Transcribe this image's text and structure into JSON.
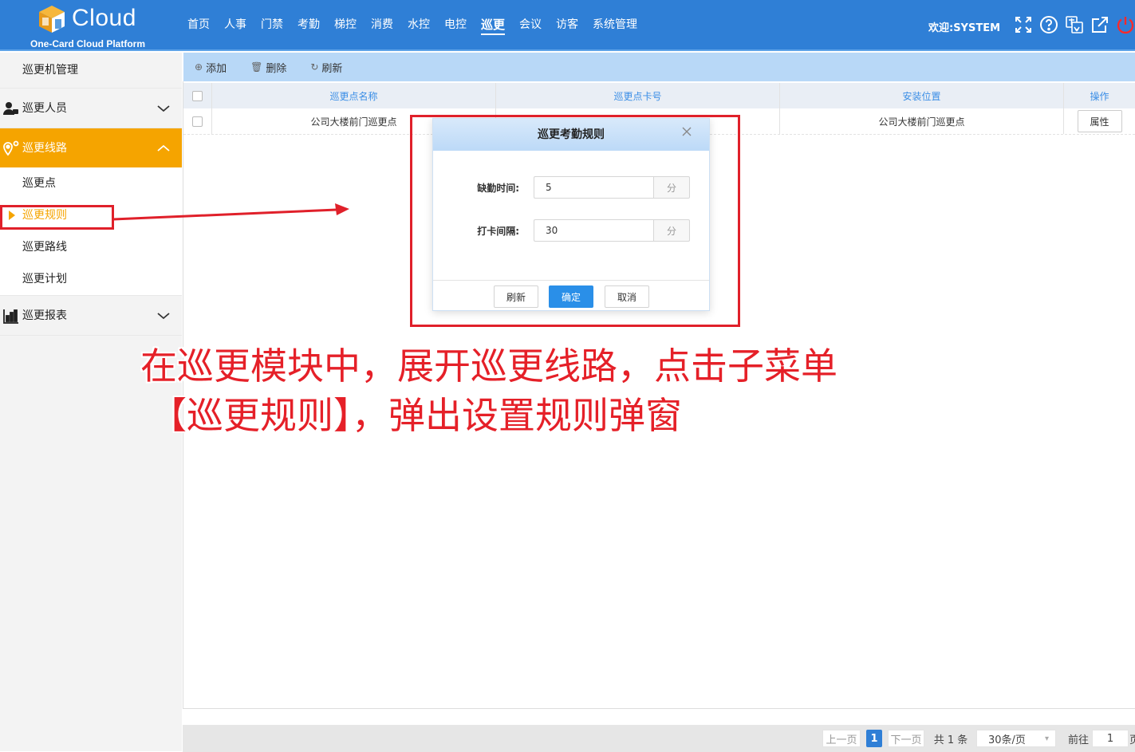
{
  "header": {
    "logo_text": "Cloud",
    "logo_subtitle": "One-Card Cloud Platform",
    "nav": [
      {
        "label": "首页"
      },
      {
        "label": "人事"
      },
      {
        "label": "门禁"
      },
      {
        "label": "考勤"
      },
      {
        "label": "梯控"
      },
      {
        "label": "消费"
      },
      {
        "label": "水控"
      },
      {
        "label": "电控"
      },
      {
        "label": "巡更",
        "active": true
      },
      {
        "label": "会议"
      },
      {
        "label": "访客"
      },
      {
        "label": "系统管理"
      }
    ],
    "welcome": "欢迎:SYSTEM",
    "icons": [
      "fullscreen-icon",
      "help-icon",
      "language-icon",
      "external-link-icon",
      "power-icon"
    ],
    "accent_color": "#2f7fd6"
  },
  "sidebar": {
    "top_item": "巡更机管理",
    "groups": [
      {
        "label": "巡更人员",
        "icon": "user-icon",
        "expanded": false
      },
      {
        "label": "巡更线路",
        "icon": "location-icon",
        "expanded": true,
        "children": [
          {
            "label": "巡更点"
          },
          {
            "label": "巡更规则",
            "active": true
          },
          {
            "label": "巡更路线"
          },
          {
            "label": "巡更计划"
          }
        ]
      },
      {
        "label": "巡更报表",
        "icon": "chart-icon",
        "expanded": false
      }
    ],
    "active_color": "#f5a400"
  },
  "toolbar": {
    "add": "添加",
    "delete": "删除",
    "refresh": "刷新"
  },
  "table": {
    "columns": [
      "巡更点名称",
      "巡更点卡号",
      "安装位置",
      "操作"
    ],
    "rows": [
      {
        "name": "公司大楼前门巡更点",
        "card": "",
        "location": "公司大楼前门巡更点",
        "action": "属性"
      }
    ]
  },
  "pagination": {
    "prev": "上一页",
    "current": "1",
    "next": "下一页",
    "total": "共 1 条",
    "page_size": "30条/页",
    "goto_label": "前往",
    "goto_value": "1",
    "page_suffix": "页"
  },
  "modal": {
    "title": "巡更考勤规则",
    "fields": [
      {
        "label": "缺勤时间:",
        "value": "5",
        "unit": "分"
      },
      {
        "label": "打卡间隔:",
        "value": "30",
        "unit": "分"
      }
    ],
    "buttons": {
      "refresh": "刷新",
      "confirm": "确定",
      "cancel": "取消"
    }
  },
  "annotation": {
    "line1": "在巡更模块中，展开巡更线路，点击子菜单",
    "line2": "【巡更规则】，弹出设置规则弹窗",
    "color": "#e52028"
  }
}
